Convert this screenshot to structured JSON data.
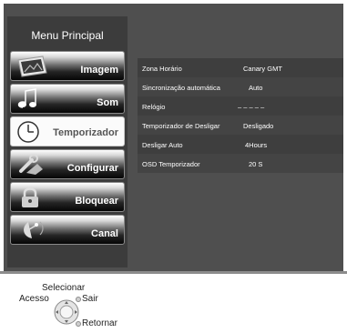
{
  "menu": {
    "title": "Menu Principal",
    "items": [
      {
        "label": "Imagem",
        "icon": "picture-icon",
        "active": false
      },
      {
        "label": "Som",
        "icon": "music-note-icon",
        "active": false
      },
      {
        "label": "Temporizador",
        "icon": "clock-icon",
        "active": true
      },
      {
        "label": "Configurar",
        "icon": "wrench-icon",
        "active": false
      },
      {
        "label": "Bloquear",
        "icon": "padlock-icon",
        "active": false
      },
      {
        "label": "Canal",
        "icon": "satellite-dish-icon",
        "active": false
      }
    ]
  },
  "settings": [
    {
      "label": "Zona Horário",
      "value": "Canary GMT"
    },
    {
      "label": "Sincronização automática",
      "value": "Auto"
    },
    {
      "label": "Relógio",
      "value": "– –  – – –"
    },
    {
      "label": "Temporizador de Desligar",
      "value": "Desligado"
    },
    {
      "label": "Desligar Auto",
      "value": "4Hours"
    },
    {
      "label": "OSD Temporizador",
      "value": "20 S"
    }
  ],
  "footer": {
    "select": "Selecionar",
    "access": "Acesso",
    "exit": "Sair",
    "back": "Retornar"
  },
  "colors": {
    "screen_bg": "#4f4f4f",
    "menu_bg": "#3c3c3c",
    "row_bg": "#3e3e3e",
    "active_item_bg": "#fbfbfb"
  }
}
